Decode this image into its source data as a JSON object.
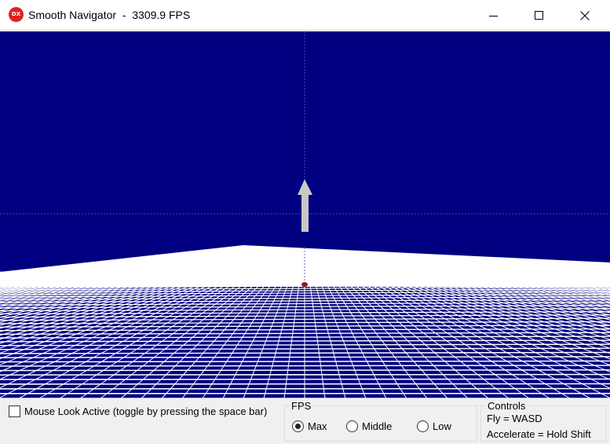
{
  "window": {
    "app_icon_text": "DX",
    "title": "Smooth Navigator  -  3309.9 FPS"
  },
  "colors": {
    "viewport_bg": "#000080",
    "grid_line": "#ffffff",
    "arrow": "#c8c8c8",
    "origin_marker": "#8b1a1a"
  },
  "bottom": {
    "mouse_look_label": "Mouse Look Active (toggle by pressing the space bar)",
    "mouse_look_checked": false,
    "fps_group": {
      "caption": "FPS",
      "options": [
        {
          "label": "Max",
          "checked": true
        },
        {
          "label": "Middle",
          "checked": false
        },
        {
          "label": "Low",
          "checked": false
        }
      ]
    },
    "controls_group": {
      "caption": "Controls",
      "lines": [
        "Fly = WASD",
        "Accelerate = Hold Shift"
      ]
    }
  }
}
